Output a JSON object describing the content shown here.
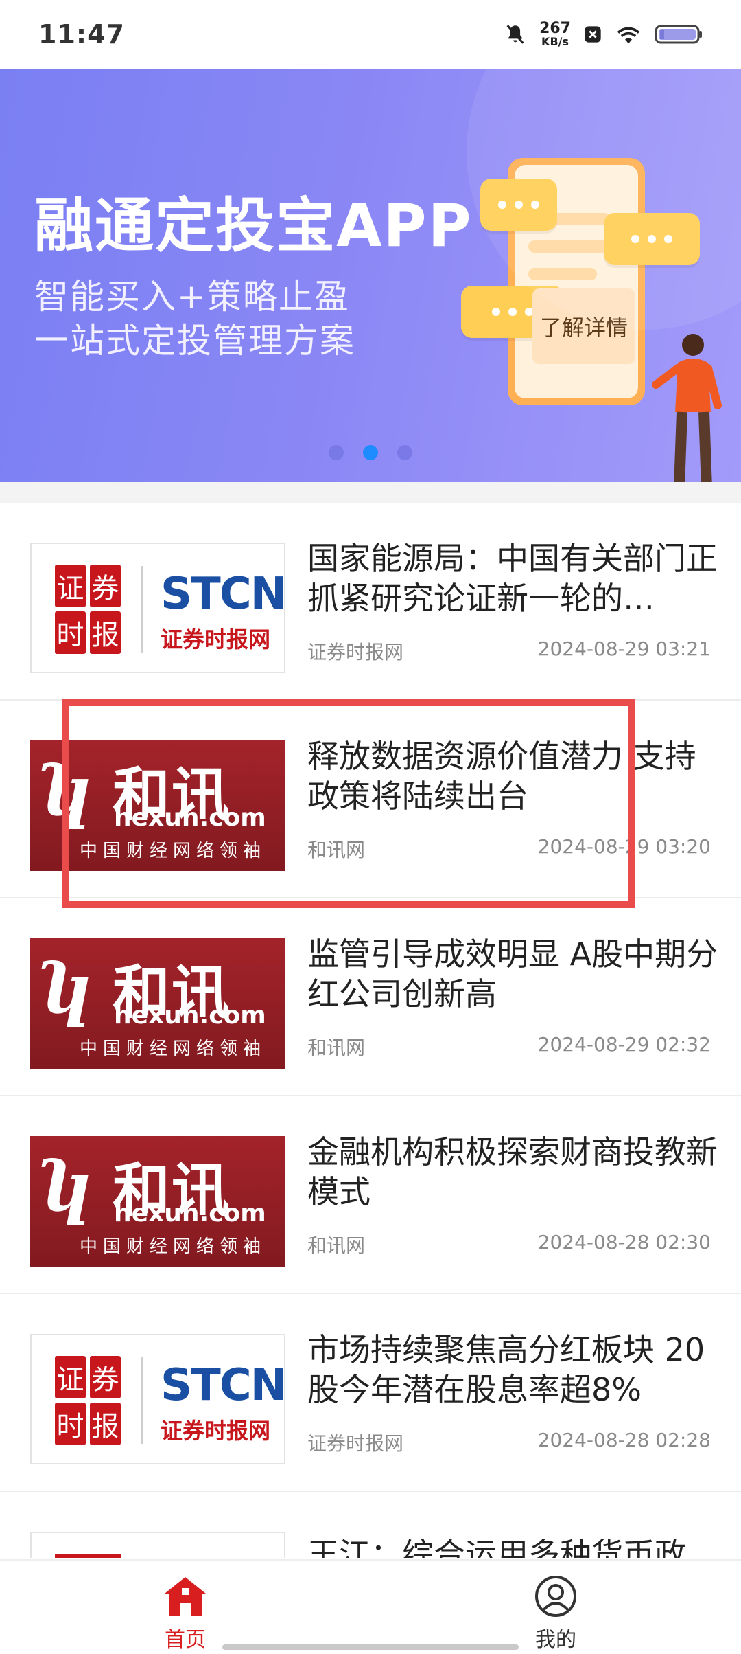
{
  "status_bar": {
    "time": "11:47",
    "net_speed_value": "267",
    "net_speed_unit": "KB/s"
  },
  "banner": {
    "title": "融通定投宝APP",
    "subtitle_line1": "智能买入+策略止盈",
    "subtitle_line2": "一站式定投管理方案",
    "cta": "了解详情",
    "active_slide_index": 1,
    "slides_total": 3
  },
  "stcn_logo": {
    "seal": [
      "证",
      "券",
      "时",
      "报"
    ],
    "word": "STCN",
    "cn": "证券时报网"
  },
  "hexun_logo": {
    "cn": "和讯",
    "en": "hexun.com",
    "slogan": "中国财经网络领袖"
  },
  "news": [
    {
      "title": "国家能源局：中国有关部门正抓紧研究论证新一轮的…",
      "source": "证券时报网",
      "time": "2024-08-29 03:21",
      "logo": "stcn"
    },
    {
      "title": "释放数据资源价值潜力 支持政策将陆续出台",
      "source": "和讯网",
      "time": "2024-08-29 03:20",
      "logo": "hexun"
    },
    {
      "title": "监管引导成效明显 A股中期分红公司创新高",
      "source": "和讯网",
      "time": "2024-08-29 02:32",
      "logo": "hexun"
    },
    {
      "title": "金融机构积极探索财商投教新模式",
      "source": "和讯网",
      "time": "2024-08-28 02:30",
      "logo": "hexun"
    },
    {
      "title": "市场持续聚焦高分红板块 20股今年潜在股息率超8%",
      "source": "证券时报网",
      "time": "2024-08-28 02:28",
      "logo": "stcn"
    },
    {
      "title": "王江：综合运用多种货币政",
      "source": "",
      "time": "",
      "logo": "stcn"
    }
  ],
  "bottom_nav": {
    "home": "首页",
    "mine": "我的"
  },
  "colors": {
    "accent_red": "#d81e1e",
    "highlight": "#ea4b4b",
    "banner_start": "#7a7ff2",
    "dot_active": "#1e8bff"
  }
}
